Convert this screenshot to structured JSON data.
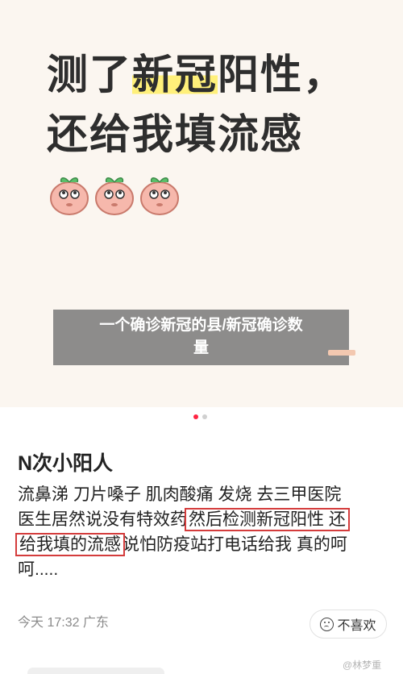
{
  "hero": {
    "line1_pre": "测了",
    "line1_highlight": "新冠",
    "line1_post": "阳性，",
    "line2": "还给我填流感"
  },
  "banner": {
    "line1": "一个确诊新冠的县/新冠确诊数",
    "line2": "量"
  },
  "note": {
    "title": "N次小阳人",
    "line1": "流鼻涕 刀片嗓子 肌肉酸痛 发烧 去三甲医院",
    "line2_pre": "医生居然说没有特效药",
    "line2_boxed": "然后检测新冠阳性 还",
    "line3_boxed": "给我填的流感",
    "line3_post": "说怕防疫站打电话给我 真的呵",
    "line4": "呵....."
  },
  "meta": {
    "time_location": "今天 17:32 广东"
  },
  "actions": {
    "dislike_label": "不喜欢"
  },
  "watermark": "@林梦重",
  "colors": {
    "accent": "#ff2442",
    "highlight": "#fff07a",
    "box_border": "#d43c3c"
  }
}
